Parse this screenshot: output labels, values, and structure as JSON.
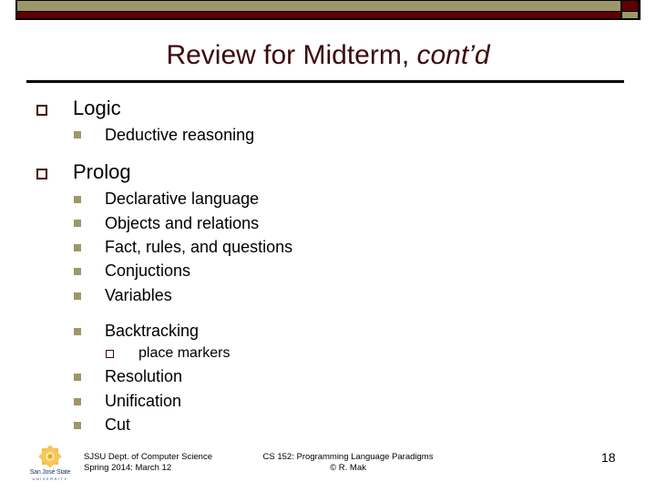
{
  "slide": {
    "title_main": "Review for Midterm, ",
    "title_italic": "cont’d",
    "sections": [
      {
        "heading": "Logic",
        "items": [
          {
            "text": "Deductive reasoning"
          }
        ]
      },
      {
        "heading": "Prolog",
        "items": [
          {
            "text": "Declarative language"
          },
          {
            "text": "Objects and relations"
          },
          {
            "text": "Fact, rules, and questions"
          },
          {
            "text": "Conjuctions"
          },
          {
            "text": "Variables"
          },
          {
            "text": "Backtracking",
            "subitems": [
              {
                "text": "place markers"
              }
            ]
          },
          {
            "text": "Resolution"
          },
          {
            "text": "Unification"
          },
          {
            "text": "Cut"
          }
        ]
      }
    ]
  },
  "footer": {
    "logo_name": "San José State",
    "logo_sub": "UNIVERSITY",
    "left_line1": "SJSU Dept. of Computer Science",
    "left_line2": "Spring 2014: March 12",
    "center_line1": "CS 152: Programming Language Paradigms",
    "center_line2": "© R. Mak",
    "page_number": "18"
  },
  "colors": {
    "olive": "#9c9869",
    "maroon": "#5e0006",
    "title": "#3b0a0c"
  }
}
